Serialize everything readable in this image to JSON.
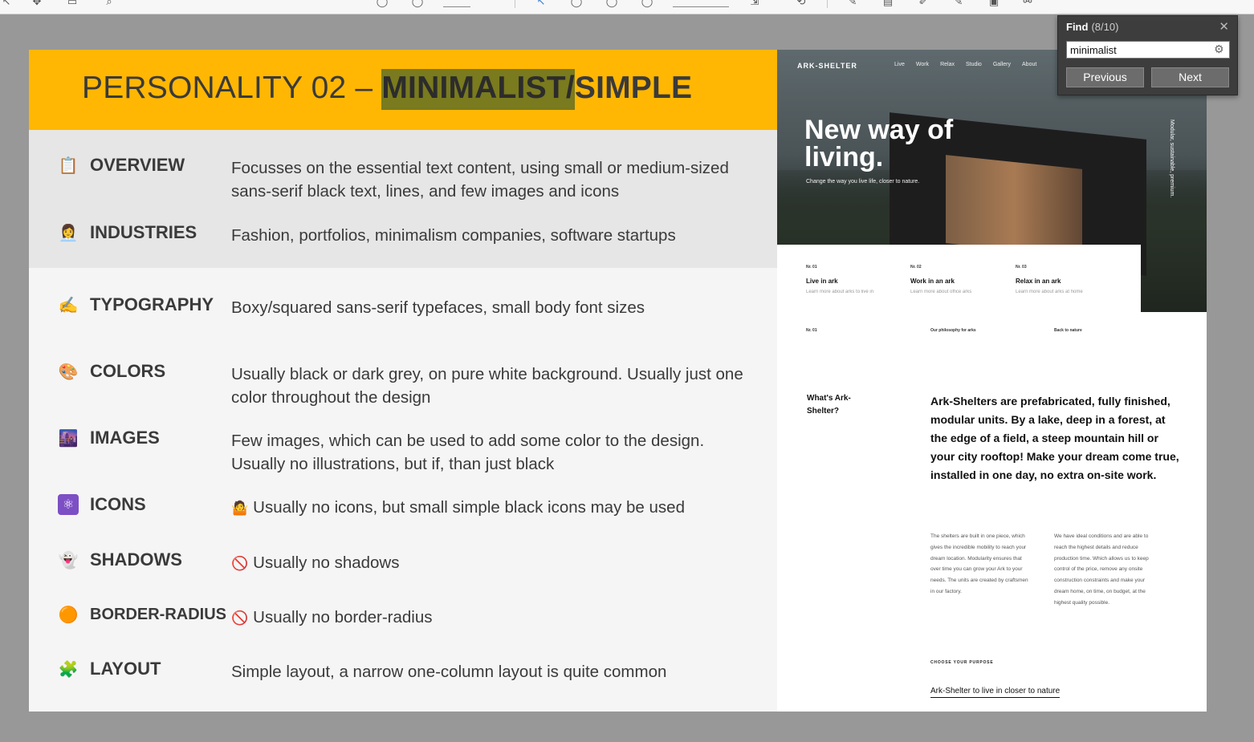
{
  "toolbar": {
    "icons": [
      "arrow-icon",
      "expand-icon",
      "document-icon",
      "search-icon",
      "zoom-out-icon",
      "zoom-in-icon",
      "cursor-icon",
      "circle-icon",
      "circle-icon",
      "circle-icon",
      "fit-icon",
      "rotate-icon",
      "comment-icon",
      "highlight-icon",
      "draw-icon",
      "pen-icon",
      "stamp-icon",
      "link-icon"
    ]
  },
  "slide": {
    "title_prefix": "PERSONALITY 02 – ",
    "title_highlight": "MINIMALIST/",
    "title_suffix": "SIMPLE",
    "accent_color": "#ffb703",
    "rows": [
      {
        "icon": "📋",
        "label": "OVERVIEW",
        "desc": "Focusses on the essential text content, using small or medium-sized sans-serif black text, lines, and few images and icons"
      },
      {
        "icon": "👩‍💼",
        "label": "INDUSTRIES",
        "desc": "Fashion, portfolios, minimalism companies, software startups"
      },
      {
        "icon": "✍️",
        "label": "TYPOGRAPHY",
        "desc": "Boxy/squared sans-serif typefaces, small body font sizes"
      },
      {
        "icon": "🎨",
        "label": "COLORS",
        "desc": "Usually black or dark grey, on pure white background. Usually just one color throughout the design"
      },
      {
        "icon": "🌆",
        "label": "IMAGES",
        "desc": "Few images, which can be used to add some color to the design. Usually no illustrations, but if, than just black"
      },
      {
        "icon": "⚛",
        "label": "ICONS",
        "desc_icon": "🤷",
        "desc": "Usually no icons, but small simple black icons may be used"
      },
      {
        "icon": "👻",
        "label": "SHADOWS",
        "desc_icon": "🚫",
        "desc": "Usually no shadows"
      },
      {
        "icon": "🟠",
        "label": "BORDER-RADIUS",
        "desc_icon": "🚫",
        "desc": "Usually no border-radius"
      },
      {
        "icon": "🧩",
        "label": "LAYOUT",
        "desc": "Simple layout, a narrow one-column layout is quite common"
      }
    ]
  },
  "site": {
    "logo": "ARK-SHELTER",
    "nav": [
      "Live",
      "Work",
      "Relax",
      "Studio",
      "Gallery",
      "About"
    ],
    "hero_title": "New way of living.",
    "hero_sub": "Change the way you live life, closer to nature.",
    "side_text": "Modular, sustainable, premium.",
    "cards": [
      {
        "no": "Nr. 01",
        "title": "Live in ark",
        "sub": "Learn more about arks to live in"
      },
      {
        "no": "Nr. 02",
        "title": "Work in an ark",
        "sub": "Learn more about office arks"
      },
      {
        "no": "Nr. 03",
        "title": "Relax in an ark",
        "sub": "Learn more about arks at home"
      }
    ],
    "meta": [
      "Nr. 01",
      "Our philosophy for arks",
      "Back to nature"
    ],
    "whats_title": "What's Ark-Shelter?",
    "lead": "Ark-Shelters are prefabricated, fully finished, modular units. By a lake, deep in a forest, at the edge of a field, a steep mountain hill or your city rooftop! Make your dream come true, installed in one day, no extra on-site work.",
    "col1": "The shelters are built in one piece, which gives the incredible mobility to reach your dream location. Modularity ensures that over time you can grow your Ark to your needs. The units are created by craftsmen in our factory.",
    "col2": "We have ideal conditions and are able to reach the highest details and reduce production time. Which allows us to keep control of the price, remove any onsite construction constraints and make your dream home, on time, on budget, at the highest quality possible.",
    "choose": "CHOOSE YOUR PURPOSE",
    "cta": "Ark-Shelter to live in closer to nature"
  },
  "find": {
    "title": "Find",
    "count": "(8/10)",
    "value": "minimalist",
    "close": "✕",
    "previous": "Previous",
    "next": "Next"
  }
}
